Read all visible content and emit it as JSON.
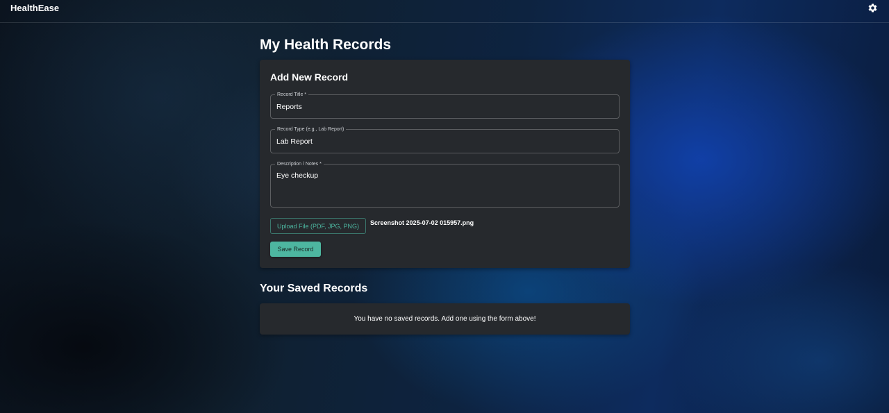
{
  "app": {
    "brand": "HealthEase",
    "settings_icon": "gear-icon"
  },
  "page": {
    "title": "My Health Records"
  },
  "form": {
    "title": "Add New Record",
    "fields": [
      {
        "label": "Record Title *",
        "value": "Reports"
      },
      {
        "label": "Record Type (e.g., Lab Report)",
        "value": "Lab Report"
      },
      {
        "label": "Description / Notes *",
        "value": "Eye checkup"
      }
    ],
    "upload_label": "Upload File (PDF, JPG, PNG)",
    "selected_file": "Screenshot 2025-07-02 015957.png",
    "save_label": "Save Record"
  },
  "saved": {
    "title": "Your Saved Records",
    "empty_message": "You have no saved records. Add one using the form above!"
  },
  "colors": {
    "accent": "#4db6a0",
    "card": "#26292d"
  }
}
